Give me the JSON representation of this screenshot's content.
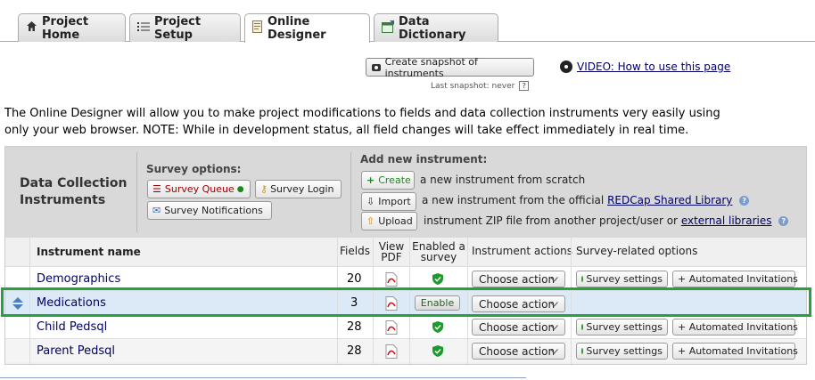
{
  "tabs": [
    {
      "label": "Project Home",
      "icon": "home-icon"
    },
    {
      "label": "Project Setup",
      "icon": "list-icon"
    },
    {
      "label": "Online Designer",
      "icon": "designer-icon",
      "active": true
    },
    {
      "label": "Data Dictionary",
      "icon": "spreadsheet-icon"
    }
  ],
  "snapshot": {
    "button_label": "Create snapshot of instruments",
    "last_snapshot": "Last snapshot: never",
    "help": "?"
  },
  "video_link": "VIDEO: How to use this page",
  "intro_text": "The Online Designer will allow you to make project modifications to fields and data collection instruments very easily using only your web browser. NOTE: While in development status, all field changes will take effect immediately in real time.",
  "panel": {
    "title_line1": "Data Collection",
    "title_line2": "Instruments",
    "survey_options_label": "Survey options:",
    "survey_queue": "Survey Queue",
    "survey_login": "Survey Login",
    "survey_notifications": "Survey Notifications",
    "add_label": "Add new instrument:",
    "create_btn": "Create",
    "create_text": "a new instrument from scratch",
    "import_btn": "Import",
    "import_text": "a new instrument from the official",
    "import_link": "REDCap Shared Library",
    "upload_btn": "Upload",
    "upload_text": "instrument ZIP file from another project/user or",
    "upload_link": "external libraries"
  },
  "columns": {
    "name": "Instrument name",
    "fields": "Fields",
    "view_pdf_1": "View",
    "view_pdf_2": "PDF",
    "enabled_1": "Enabled a",
    "enabled_2": "survey",
    "actions": "Instrument actions",
    "survey_related": "Survey-related options"
  },
  "rows": [
    {
      "name": "Demographics",
      "fields": "20",
      "survey": true
    },
    {
      "name": "Medications",
      "fields": "3",
      "survey": false,
      "enable_label": "Enable"
    },
    {
      "name": "Child Pedsql",
      "fields": "28",
      "survey": true
    },
    {
      "name": "Parent Pedsql",
      "fields": "28",
      "survey": true
    }
  ],
  "choose_action": "Choose action",
  "survey_settings": "Survey settings",
  "automated_invitations": "+ Automated Invitations",
  "colors": {
    "highlight": "#22a33f",
    "link": "#000066",
    "selected_row": "#dbeaf6"
  }
}
